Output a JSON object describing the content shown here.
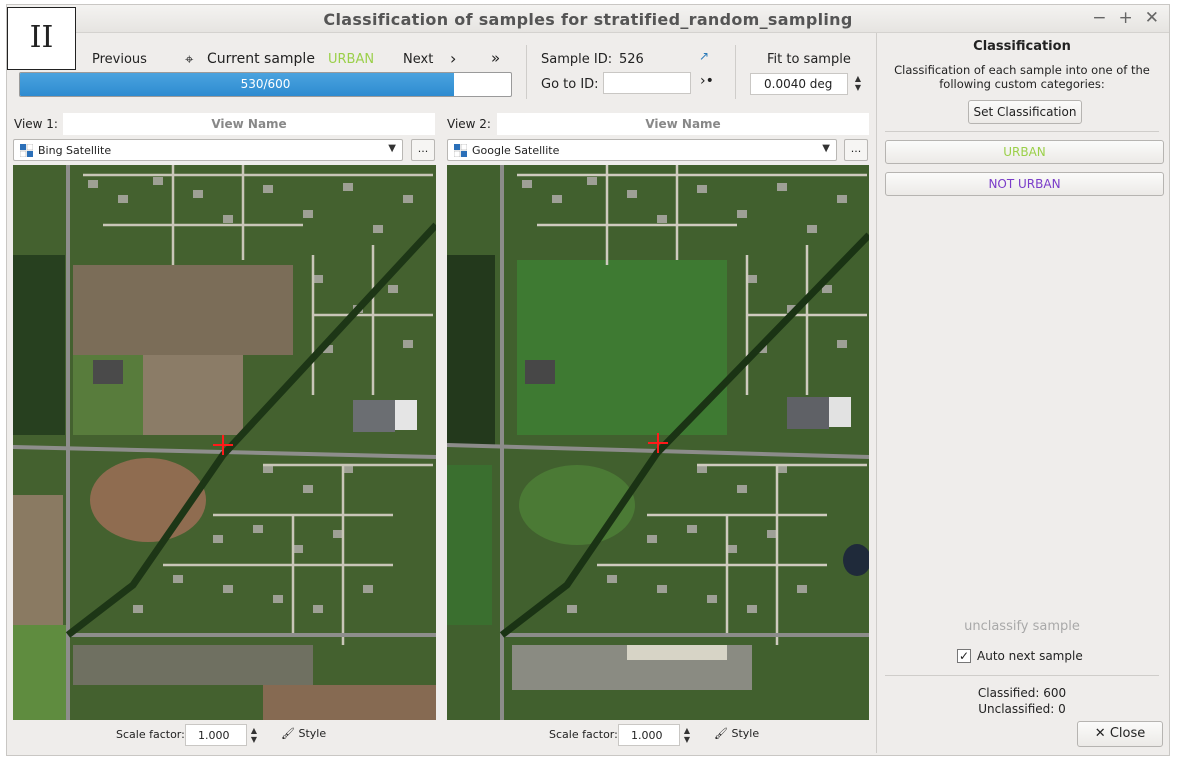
{
  "panel_marker": "II",
  "window": {
    "title": "Classification of samples for stratified_random_sampling",
    "controls": [
      "−",
      "+",
      "✕"
    ]
  },
  "toolbar": {
    "previous_label": "Previous",
    "current_sample_label": "Current sample",
    "current_class": "URBAN",
    "next_label": "Next",
    "progress_text": "530/600",
    "progress_fraction": 0.883,
    "sample_id_label": "Sample ID:",
    "sample_id_value": "526",
    "goto_label": "Go to ID:",
    "goto_value": "",
    "fit_label": "Fit to sample",
    "fit_value": "0.0040 deg"
  },
  "view1": {
    "label": "View 1:",
    "name_placeholder": "View Name",
    "layer": "Bing Satellite",
    "ellipsis": "...",
    "scale_label": "Scale factor:",
    "scale_value": "1.000",
    "style_label": "Style"
  },
  "view2": {
    "label": "View 2:",
    "name_placeholder": "View Name",
    "layer": "Google Satellite",
    "ellipsis": "...",
    "scale_label": "Scale factor:",
    "scale_value": "1.000",
    "style_label": "Style"
  },
  "classification": {
    "title": "Classification",
    "description": "Classification of each sample into one of the following custom categories:",
    "set_button": "Set Classification",
    "categories": [
      {
        "label": "URBAN",
        "color": "#9bd04a"
      },
      {
        "label": "NOT URBAN",
        "color": "#7a3cc9"
      }
    ],
    "unclassify_label": "unclassify sample",
    "auto_next_label": "Auto next sample",
    "auto_next_checked": true,
    "classified_text": "Classified: 600",
    "unclassified_text": "Unclassified: 0",
    "close_label": "Close"
  },
  "colors": {
    "progress": "#2e8bd0",
    "urban": "#9bd04a",
    "not_urban": "#7a3cc9",
    "crosshair": "#ff1a1a"
  }
}
